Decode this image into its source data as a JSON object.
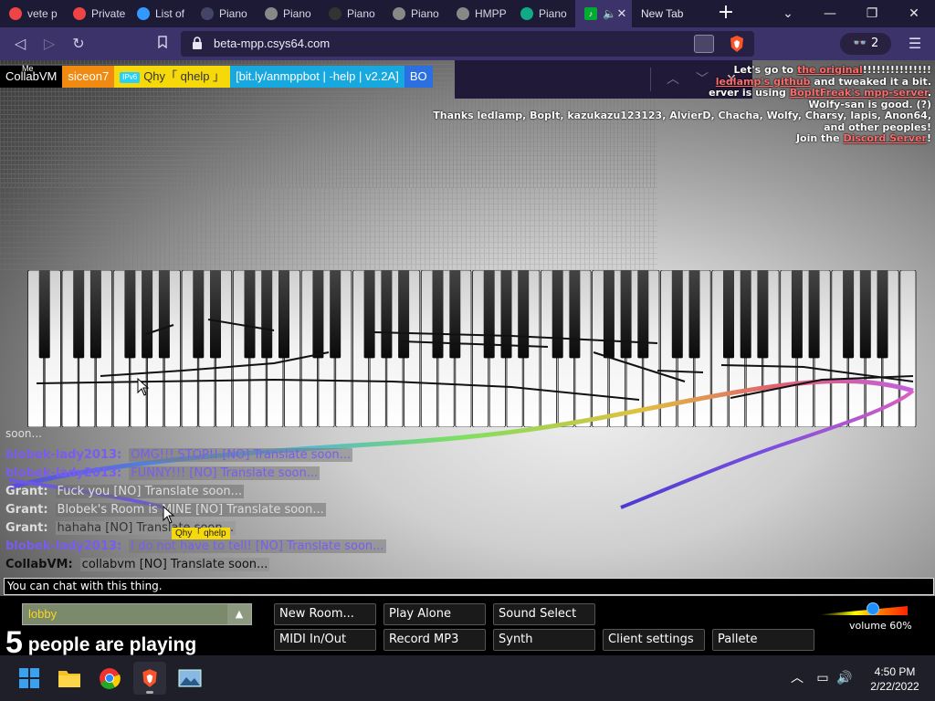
{
  "browser": {
    "tabs": [
      {
        "label": "vete p",
        "icon": "site-icon",
        "color": "#e44"
      },
      {
        "label": "Private",
        "icon": "brave-icon",
        "color": "#e44"
      },
      {
        "label": "List of",
        "icon": "hub-icon",
        "color": "#39f"
      },
      {
        "label": "Piano",
        "icon": "piano-site-icon",
        "color": "#446"
      },
      {
        "label": "Piano",
        "icon": "globe-icon",
        "color": "#888"
      },
      {
        "label": "Piano",
        "icon": "piano-site-icon",
        "color": "#333"
      },
      {
        "label": "Piano",
        "icon": "globe-icon",
        "color": "#888"
      },
      {
        "label": "HMPP",
        "icon": "globe-icon",
        "color": "#888"
      },
      {
        "label": "Piano",
        "icon": "d-icon",
        "color": "#1a8"
      }
    ],
    "new_tab_label": "New Tab",
    "url": "beta-mpp.csys64.com",
    "vpn_count": "2"
  },
  "piano_app": {
    "me_label": "Me",
    "users": [
      {
        "name": "CollabVM",
        "bg": "#000000",
        "tag": ""
      },
      {
        "name": "siceon7",
        "bg": "#f08a10",
        "tag": ""
      },
      {
        "name": "Qhy「 qhelp 」",
        "bg": "#f5d90a",
        "tag": "IPv6",
        "tag_bg": "#2ad0f5",
        "color": "#333"
      },
      {
        "name": "[bit.ly/anmppbot | -help | v2.2A]",
        "bg": "#18a8e0",
        "tag": ""
      },
      {
        "name": "BO",
        "bg": "#2b6fe0",
        "tag": ""
      }
    ],
    "credits": {
      "line1_a": "Let's go to ",
      "line1_link": "the original",
      "line1_b": "!!!!!!!!!!!!!!!",
      "line2_link": "ledlamp's github",
      "line2_b": " and tweaked it a bit.",
      "line3_a": "erver is using ",
      "line3_link": "BopItFreak's mpp-server",
      "line3_b": ".",
      "line4": "Wolfy-san is good. (?)",
      "line5": "Thanks ledlamp, BopIt, kazukazu123123, AlvierD, Chacha, Wolfy, Charsy, lapis, Anon64, and other peoples!",
      "line6_a": "Join the ",
      "line6_link": "Discord Server",
      "line6_b": "!"
    },
    "soon_text": "soon...",
    "chat": [
      {
        "nick": "blobek-lady2013:",
        "msg": "OMG!!! STOP!! [NO] Translate soon...",
        "nick_color": "#7a5cf0",
        "msg_color": "#7a5cf0",
        "msg_bg": "rgba(120,120,120,0.55)"
      },
      {
        "nick": "blobek-lady2013:",
        "msg": "FUNNY!!! [NO] Translate soon...",
        "nick_color": "#7a5cf0",
        "msg_color": "#7a5cf0",
        "msg_bg": "rgba(120,120,120,0.55)"
      },
      {
        "nick": "Grant:",
        "msg": "Fuck you [NO] Translate soon...",
        "nick_color": "#dddddd",
        "msg_color": "#dddddd",
        "msg_bg": "rgba(110,110,110,0.55)"
      },
      {
        "nick": "Grant:",
        "msg": "Blobek's Room is MINE [NO] Translate soon...",
        "nick_color": "#dddddd",
        "msg_color": "#dddddd",
        "msg_bg": "rgba(110,110,110,0.55)"
      },
      {
        "nick": "Grant:",
        "msg": "hahaha [NO] Translate soon...",
        "nick_color": "#dddddd",
        "msg_color": "#333333",
        "msg_bg": "rgba(150,150,150,0.55)"
      },
      {
        "nick": "blobek-lady2013:",
        "msg": "I do not have to tell! [NO] Translate soon...",
        "nick_color": "#7a5cf0",
        "msg_color": "#7a5cf0",
        "msg_bg": "rgba(120,120,120,0.55)"
      },
      {
        "nick": "CollabVM:",
        "msg": "collabvm [NO] Translate soon...",
        "nick_color": "#111111",
        "msg_color": "#111111",
        "msg_bg": "rgba(140,140,140,0.55)"
      }
    ],
    "cursor_label": "Qhy「 qhelp",
    "chat_placeholder": "You can chat with this thing.",
    "room": "lobby",
    "playing_count": "5",
    "playing_text": " people are playing",
    "buttons": {
      "new_room": "New Room...",
      "play_alone": "Play Alone",
      "sound_select": "Sound Select",
      "midi": "MIDI In/Out",
      "record": "Record MP3",
      "synth": "Synth",
      "client_settings": "Client settings",
      "pallete": "Pallete"
    },
    "volume_label": "volume 60%",
    "volume_value": 0.6
  },
  "taskbar": {
    "time": "4:50 PM",
    "date": "2/22/2022"
  }
}
